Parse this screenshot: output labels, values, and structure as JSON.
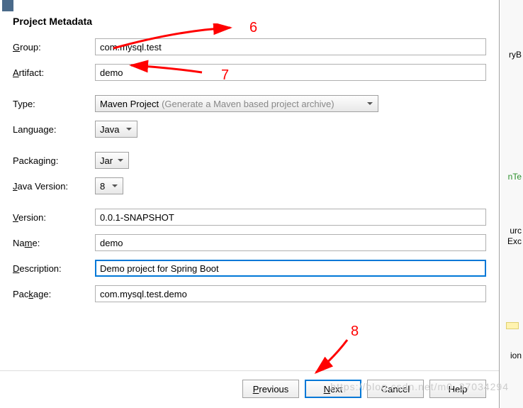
{
  "dialog": {
    "section_title": "Project Metadata",
    "labels": {
      "group": "Group:",
      "artifact": "Artifact:",
      "type": "Type:",
      "language": "Language:",
      "packaging": "Packaging:",
      "java_version": "Java Version:",
      "version": "Version:",
      "name": "Name:",
      "description": "Description:",
      "package": "Package:"
    },
    "values": {
      "group": "com.mysql.test",
      "artifact": "demo",
      "type": "Maven Project",
      "type_hint": "(Generate a Maven based project archive)",
      "language": "Java",
      "packaging": "Jar",
      "java_version": "8",
      "version": "0.0.1-SNAPSHOT",
      "name": "demo",
      "description": "Demo project for Spring Boot",
      "package": "com.mysql.test.demo"
    },
    "buttons": {
      "previous": "Previous",
      "next": "Next",
      "cancel": "Cancel",
      "help": "Help"
    }
  },
  "annotations": {
    "n6": "6",
    "n7": "7",
    "n8": "8"
  },
  "bg": {
    "frag1": "ryB",
    "frag2": "nTe",
    "frag3": "urc",
    "frag4": "Exc",
    "frag5": "ion"
  },
  "watermark": "https://blog.csdn.net/m0_37034294"
}
